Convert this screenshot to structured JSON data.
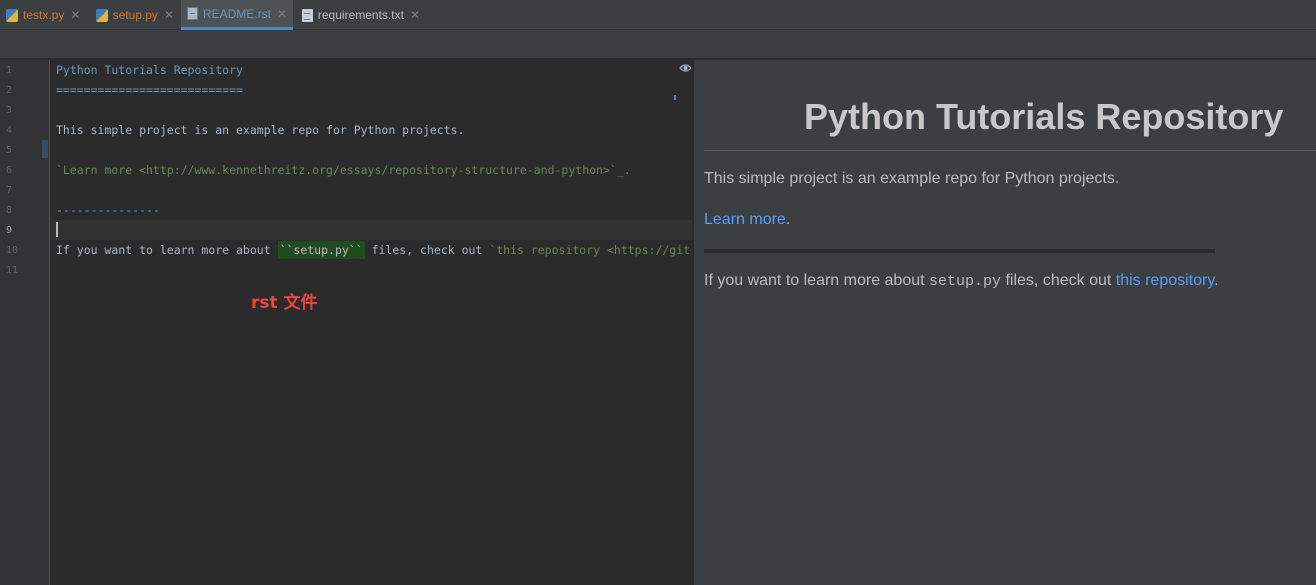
{
  "tabs": [
    {
      "label": "testx.py",
      "icon": "python-file-icon",
      "color": "#cc7832",
      "active": false
    },
    {
      "label": "setup.py",
      "icon": "python-file-icon",
      "color": "#cc7832",
      "active": false
    },
    {
      "label": "README.rst",
      "icon": "rst-file-icon",
      "color": "#6897bb",
      "active": true
    },
    {
      "label": "requirements.txt",
      "icon": "text-file-icon",
      "color": "#bbbbbb",
      "active": false
    }
  ],
  "editor": {
    "line_numbers": [
      "1",
      "2",
      "3",
      "4",
      "5",
      "6",
      "7",
      "8",
      "9",
      "10",
      "11"
    ],
    "current_line": "9",
    "lines": {
      "l1": "Python Tutorials Repository",
      "l2": "===========================",
      "l4": "This simple project is an example repo for Python projects.",
      "l6": "`Learn more <http://www.kennethreitz.org/essays/repository-structure-and-python>`_.",
      "l8": "---------------",
      "l10_pre": "If you want to learn more about ",
      "l10_lit": "``setup.py``",
      "l10_mid": " files, check out ",
      "l10_link": "`this repository <https://git"
    },
    "annotation": "rst 文件"
  },
  "preview": {
    "title": "Python Tutorials Repository",
    "p1": "This simple project is an example repo for Python projects.",
    "p2_link": "Learn more",
    "p2_end": ".",
    "p3_pre": "If you want to learn more about ",
    "p3_code": "setup.py",
    "p3_mid": " files, check out ",
    "p3_link": "this repository",
    "p3_end": "."
  },
  "colors": {
    "accent": "#4a88c7",
    "annotation": "#f0423f",
    "link": "#589df6"
  }
}
